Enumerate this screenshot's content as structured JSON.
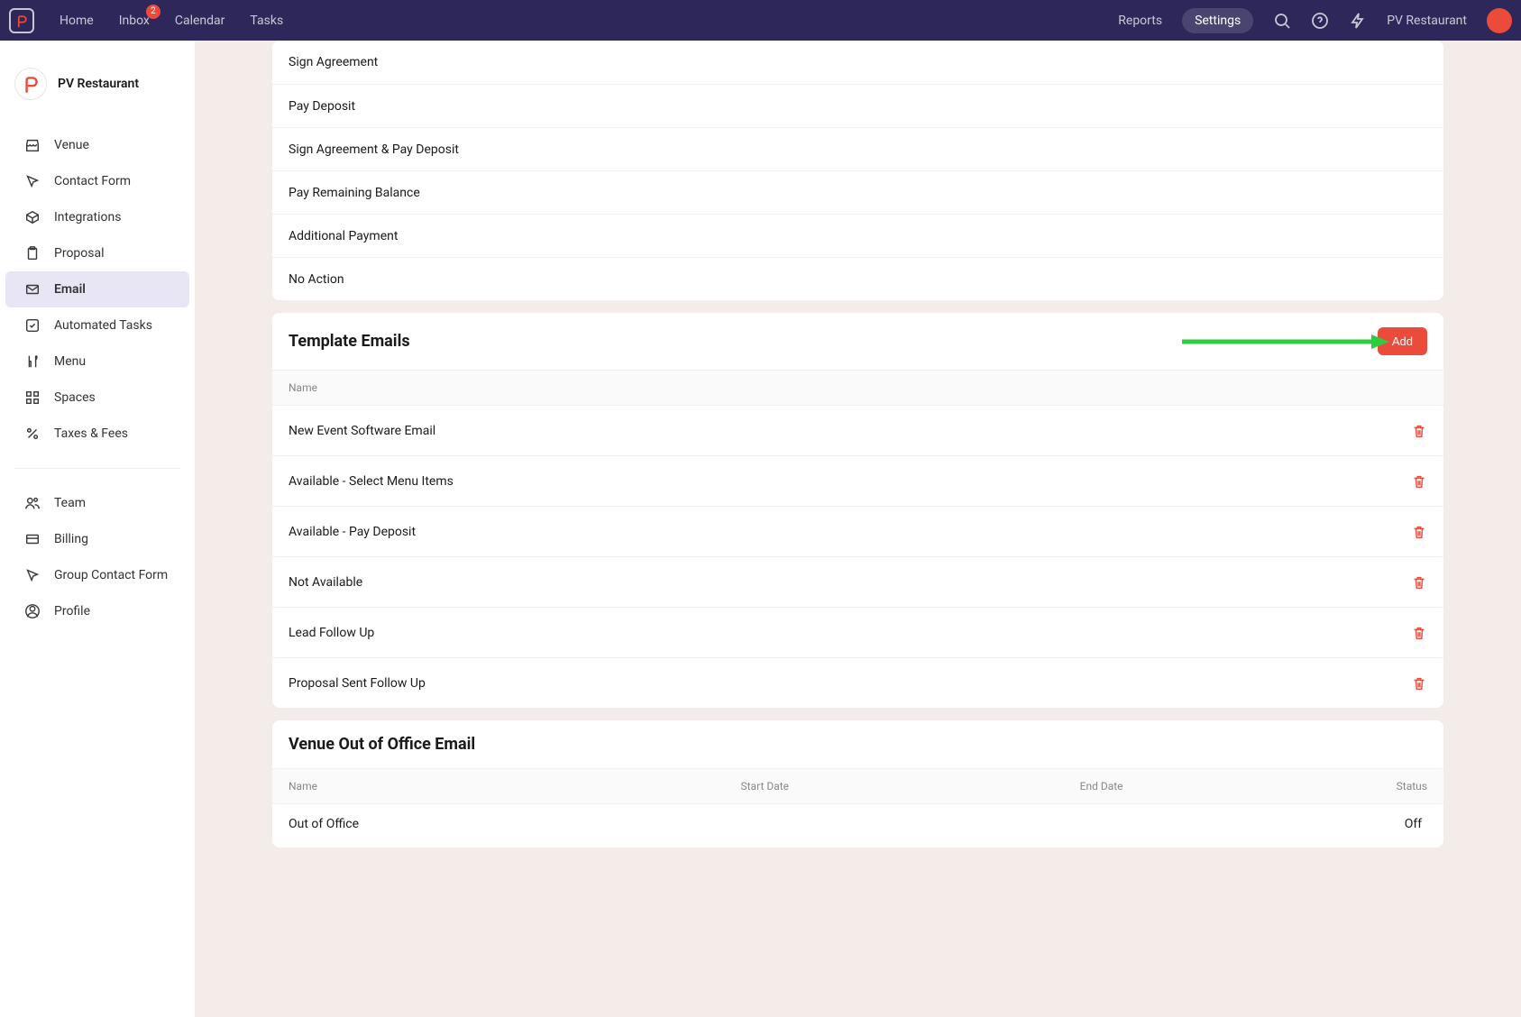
{
  "topbar": {
    "nav": [
      {
        "label": "Home"
      },
      {
        "label": "Inbox",
        "badge": "2"
      },
      {
        "label": "Calendar"
      },
      {
        "label": "Tasks"
      }
    ],
    "right_links": [
      {
        "label": "Reports",
        "active": false
      },
      {
        "label": "Settings",
        "active": true
      }
    ],
    "org_name": "PV Restaurant"
  },
  "sidebar": {
    "org_name": "PV Restaurant",
    "groups": [
      [
        {
          "label": "Venue",
          "icon": "storefront-icon",
          "active": false
        },
        {
          "label": "Contact Form",
          "icon": "cursor-icon",
          "active": false
        },
        {
          "label": "Integrations",
          "icon": "box-icon",
          "active": false
        },
        {
          "label": "Proposal",
          "icon": "clipboard-icon",
          "active": false
        },
        {
          "label": "Email",
          "icon": "mail-icon",
          "active": true
        },
        {
          "label": "Automated Tasks",
          "icon": "checkbox-icon",
          "active": false
        },
        {
          "label": "Menu",
          "icon": "utensils-icon",
          "active": false
        },
        {
          "label": "Spaces",
          "icon": "grid-icon",
          "active": false
        },
        {
          "label": "Taxes & Fees",
          "icon": "percent-icon",
          "active": false
        }
      ],
      [
        {
          "label": "Team",
          "icon": "users-icon",
          "active": false
        },
        {
          "label": "Billing",
          "icon": "card-icon",
          "active": false
        },
        {
          "label": "Group Contact Form",
          "icon": "cursor-icon",
          "active": false
        },
        {
          "label": "Profile",
          "icon": "person-icon",
          "active": false
        }
      ]
    ]
  },
  "actions_card": {
    "items": [
      "Sign Agreement",
      "Pay Deposit",
      "Sign Agreement & Pay Deposit",
      "Pay Remaining Balance",
      "Additional Payment",
      "No Action"
    ]
  },
  "template_emails": {
    "title": "Template Emails",
    "add_label": "Add",
    "column_name": "Name",
    "items": [
      "New Event Software Email",
      "Available - Select Menu Items",
      "Available - Pay Deposit",
      "Not Available",
      "Lead Follow Up",
      "Proposal Sent Follow Up"
    ]
  },
  "out_of_office": {
    "title": "Venue Out of Office Email",
    "columns": [
      "Name",
      "Start Date",
      "End Date",
      "Status"
    ],
    "row": {
      "name": "Out of Office",
      "start_date": "",
      "end_date": "",
      "status": "Off"
    }
  }
}
